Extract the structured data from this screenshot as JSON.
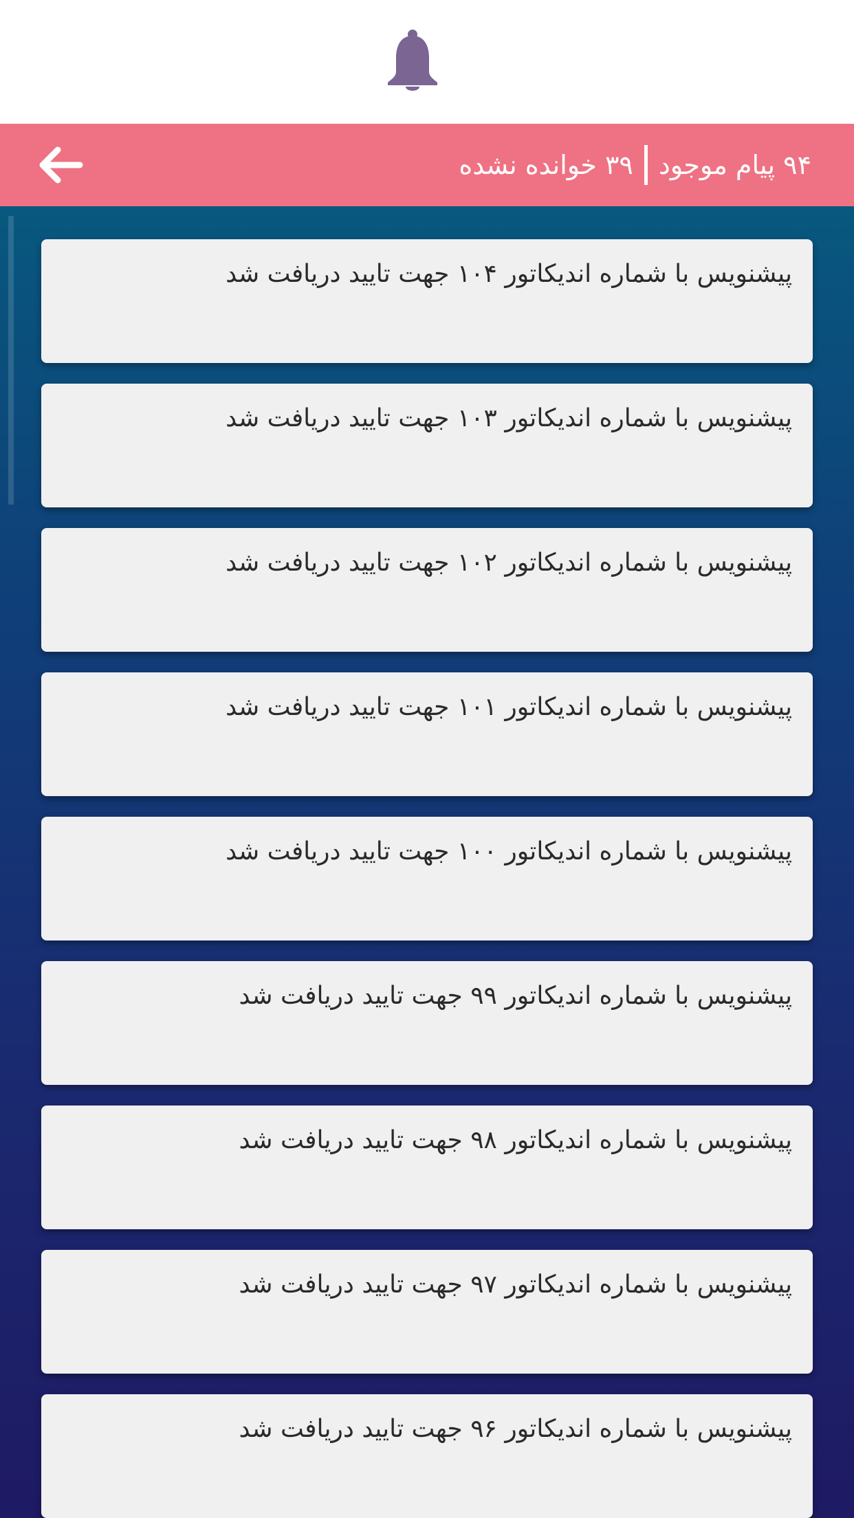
{
  "header": {
    "total_count": "۹۴",
    "total_label": "پیام موجود",
    "unread_count": "۳۹",
    "unread_label": "خوانده نشده"
  },
  "icons": {
    "notification": "bell-icon",
    "back": "arrow-left-icon"
  },
  "colors": {
    "header_bar": "#ee7283",
    "bell": "#7a6593",
    "card": "#f0f0f0",
    "content_gradient_top": "#08587f",
    "content_gradient_bottom": "#1e1a63"
  },
  "messages": [
    {
      "text": "پیشنویس با شماره اندیکاتور ۱۰۴ جهت تایید دریافت شد"
    },
    {
      "text": "پیشنویس با شماره اندیکاتور ۱۰۳ جهت تایید دریافت شد"
    },
    {
      "text": "پیشنویس با شماره اندیکاتور ۱۰۲ جهت تایید دریافت شد"
    },
    {
      "text": "پیشنویس با شماره اندیکاتور ۱۰۱ جهت تایید دریافت شد"
    },
    {
      "text": "پیشنویس با شماره اندیکاتور ۱۰۰ جهت تایید دریافت شد"
    },
    {
      "text": "پیشنویس با شماره اندیکاتور ۹۹ جهت تایید دریافت شد"
    },
    {
      "text": "پیشنویس با شماره اندیکاتور ۹۸ جهت تایید دریافت شد"
    },
    {
      "text": "پیشنویس با شماره اندیکاتور ۹۷ جهت تایید دریافت شد"
    },
    {
      "text": "پیشنویس با شماره اندیکاتور ۹۶ جهت تایید دریافت شد"
    }
  ]
}
